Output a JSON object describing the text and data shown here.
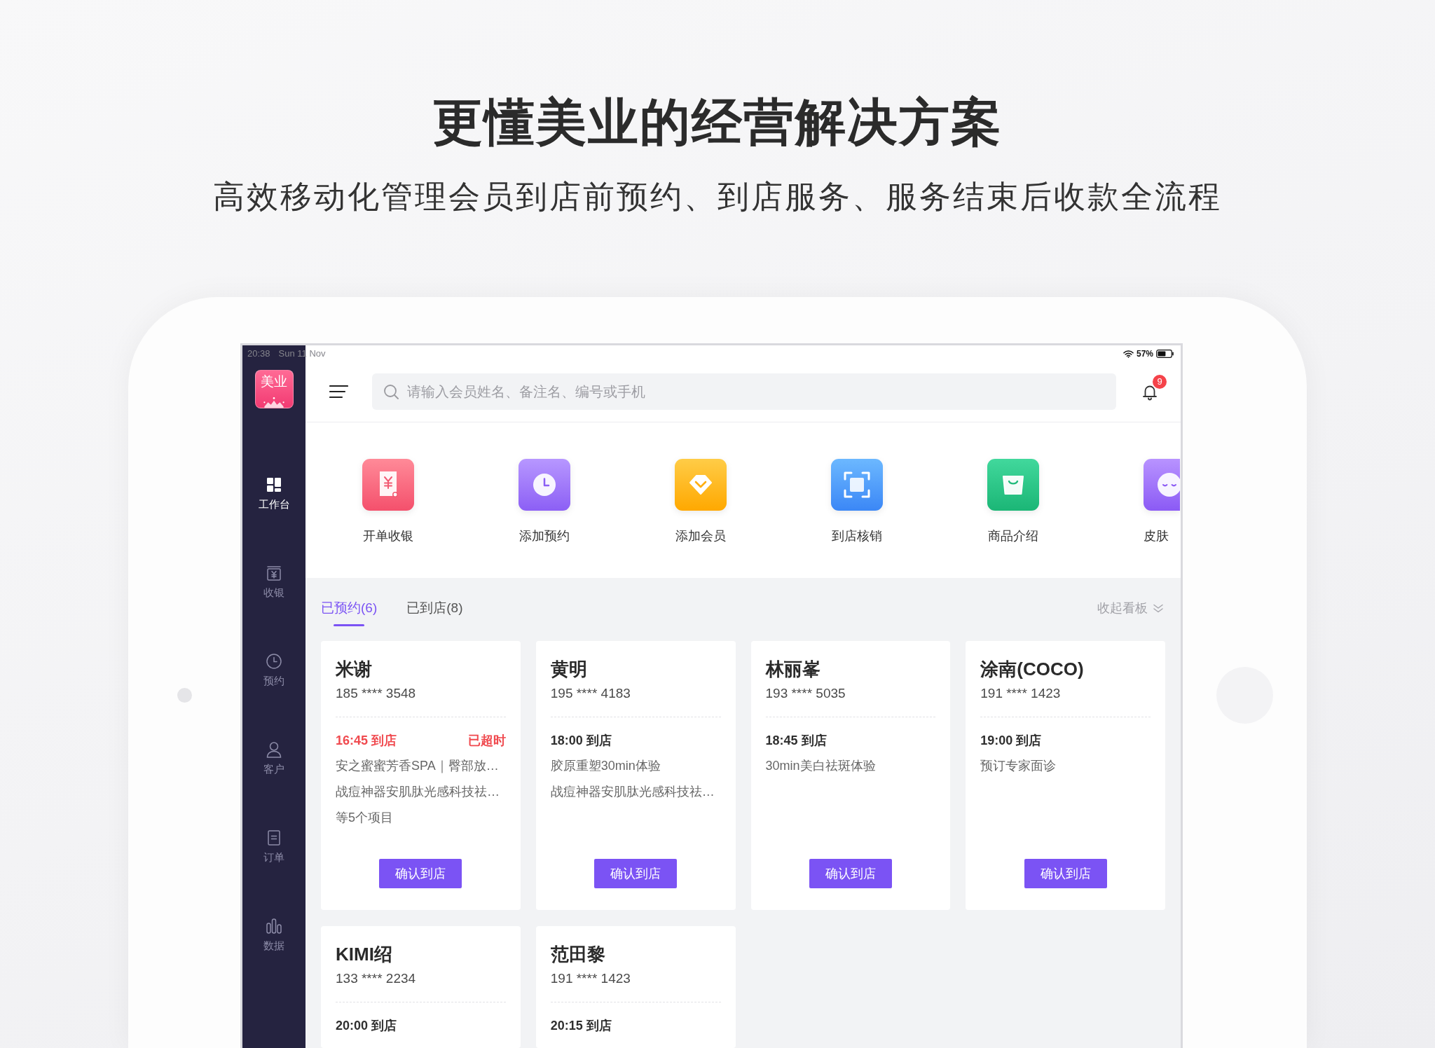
{
  "headline": {
    "title": "更懂美业的经营解决方案",
    "subtitle": "高效移动化管理会员到店前预约、到店服务、服务结束后收款全流程"
  },
  "status_bar": {
    "time": "20:38",
    "date": "Sun 11 Nov",
    "battery": "57%"
  },
  "logo": {
    "text": "美业"
  },
  "sidebar": {
    "items": [
      {
        "label": "工作台",
        "kind": "dashboard",
        "selected": true
      },
      {
        "label": "收银",
        "kind": "cashier",
        "selected": false
      },
      {
        "label": "预约",
        "kind": "clock",
        "selected": false
      },
      {
        "label": "客户",
        "kind": "person",
        "selected": false
      },
      {
        "label": "订单",
        "kind": "document",
        "selected": false
      },
      {
        "label": "数据",
        "kind": "chart",
        "selected": false
      }
    ]
  },
  "search": {
    "placeholder": "请输入会员姓名、备注名、编号或手机"
  },
  "notifications": {
    "count": "9"
  },
  "quick_actions": [
    {
      "label": "开单收银",
      "kind": "receipt"
    },
    {
      "label": "添加预约",
      "kind": "clock"
    },
    {
      "label": "添加会员",
      "kind": "diamond"
    },
    {
      "label": "到店核销",
      "kind": "scan"
    },
    {
      "label": "商品介绍",
      "kind": "bag"
    },
    {
      "label": "皮肤",
      "kind": "face"
    }
  ],
  "tabs": [
    {
      "label": "已预约(6)",
      "selected": true
    },
    {
      "label": "已到店(8)",
      "selected": false
    }
  ],
  "collapse_link": {
    "label": "收起看板"
  },
  "appointments": [
    {
      "name": "米谢",
      "phone": "185 **** 3548",
      "time": "16:45 到店",
      "overdue": true,
      "status": "已超时",
      "services": [
        "安之蜜蜜芳香SPA｜臀部放…",
        "战痘神器安肌肽光感科技祛…",
        "等5个项目"
      ],
      "button": "确认到店"
    },
    {
      "name": "黄明",
      "phone": "195 **** 4183",
      "time": "18:00 到店",
      "overdue": false,
      "services": [
        "胶原重塑30min体验",
        "战痘神器安肌肽光感科技祛…"
      ],
      "button": "确认到店"
    },
    {
      "name": "林丽峯",
      "phone": "193 **** 5035",
      "time": "18:45 到店",
      "overdue": false,
      "services": [
        "30min美白祛斑体验"
      ],
      "button": "确认到店"
    },
    {
      "name": "涂南(COCO)",
      "phone": "191 **** 1423",
      "time": "19:00 到店",
      "overdue": false,
      "services": [
        "预订专家面诊"
      ],
      "button": "确认到店"
    },
    {
      "name": "KIMI绍",
      "phone": "133 **** 2234",
      "time": "20:00 到店",
      "overdue": false
    },
    {
      "name": "范田黎",
      "phone": "191 **** 1423",
      "time": "20:15 到店",
      "overdue": false
    }
  ]
}
